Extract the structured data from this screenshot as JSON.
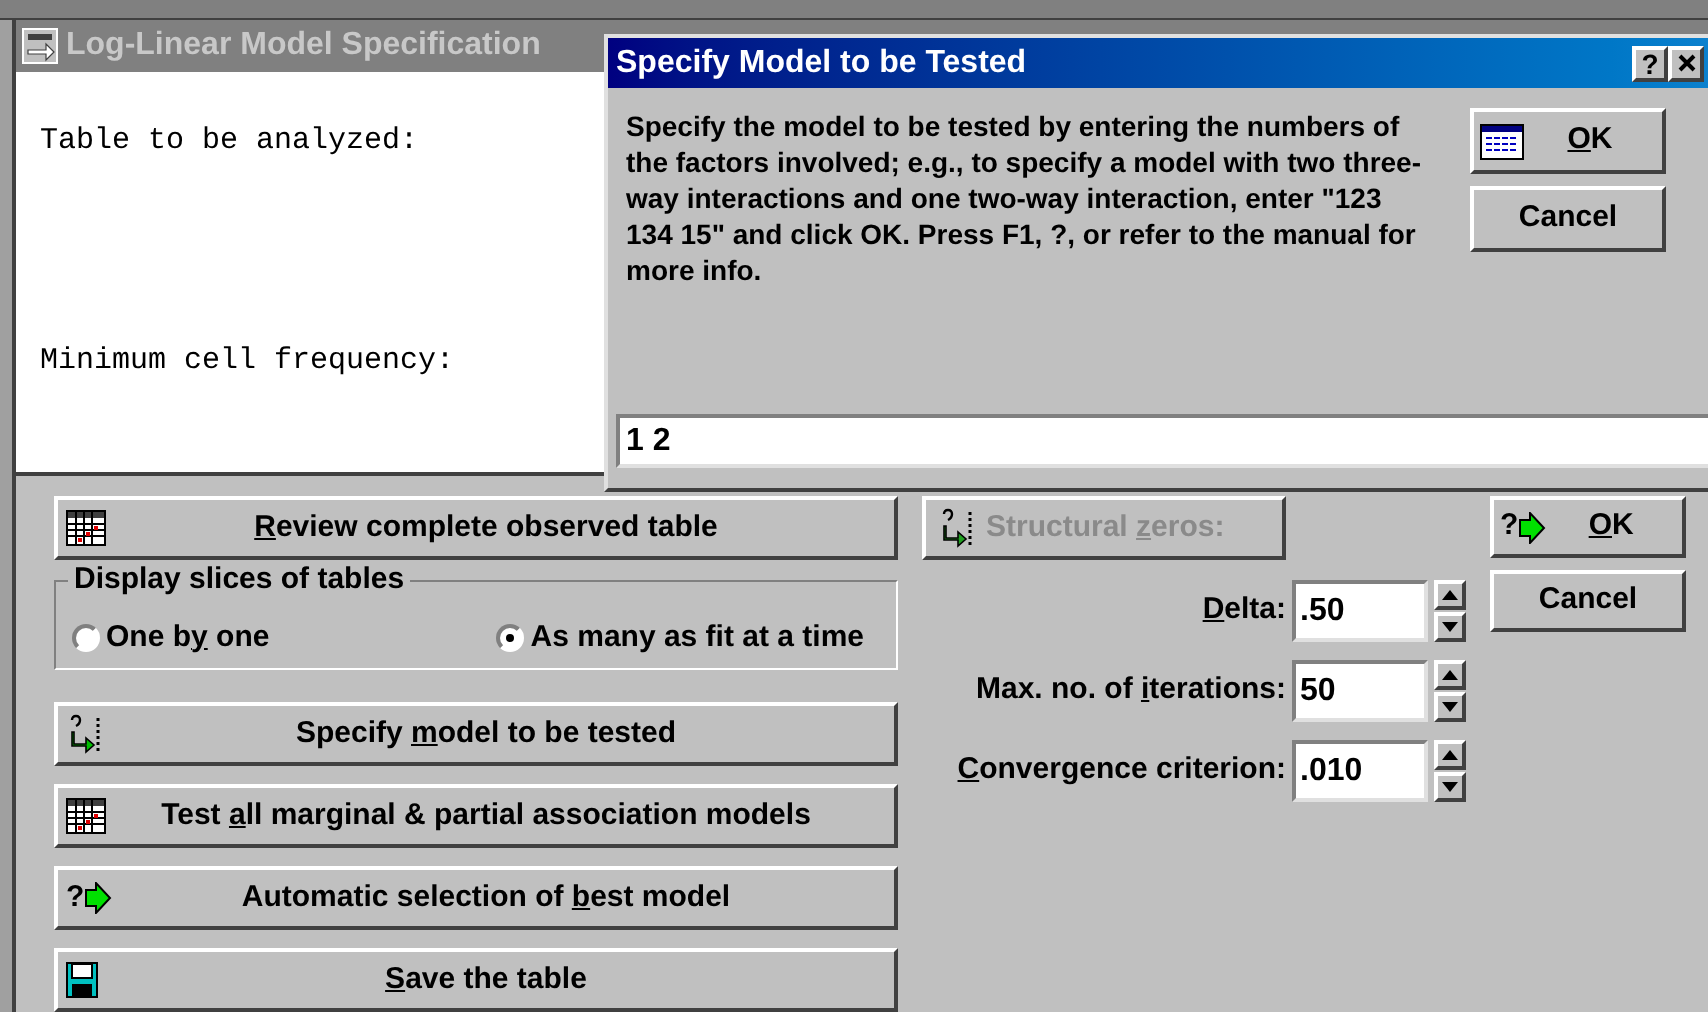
{
  "main_window": {
    "title": "Log-Linear Model Specification",
    "info_labels": [
      "Table to be analyzed:",
      "Minimum cell frequency:"
    ],
    "top_actions": [
      {
        "kind": "table",
        "label": {
          "key": "R",
          "post": "eview complete observed table"
        }
      }
    ],
    "display_slices": {
      "title": "Display slices of tables",
      "options": [
        {
          "label": {
            "pre": "One b",
            "key": "y",
            "post": " one"
          },
          "selected": false
        },
        {
          "label": {
            "pre": "As many as fit at a time"
          },
          "selected": true
        }
      ]
    },
    "actions": [
      {
        "kind": "model",
        "label": {
          "pre": "Specify ",
          "key": "m",
          "post": "odel to be tested"
        }
      },
      {
        "kind": "table",
        "label": {
          "pre": "Test ",
          "key": "a",
          "post": "ll marginal & partial association models"
        }
      },
      {
        "kind": "auto",
        "help_mark": "?",
        "label": {
          "pre": "Automatic selection of ",
          "key": "b",
          "post": "est model"
        }
      },
      {
        "kind": "save",
        "label": {
          "key": "S",
          "post": "ave the table"
        }
      }
    ],
    "structural_zeros": {
      "label": {
        "pre": "Structural ",
        "key": "z",
        "post": "eros:"
      },
      "disabled": true
    },
    "parameters": [
      {
        "label": {
          "key": "D",
          "post": "elta:"
        },
        "value": ".50"
      },
      {
        "label": {
          "pre": "Max. no. of ",
          "key": "i",
          "post": "terations:"
        },
        "value": "50"
      },
      {
        "label": {
          "key": "C",
          "post": "onvergence criterion:"
        },
        "value": ".010"
      }
    ],
    "buttons": [
      {
        "kind": "ok",
        "help_mark": "?",
        "label": {
          "key": "O",
          "post": "K"
        }
      },
      {
        "kind": "cancel",
        "label": {
          "pre": "Cancel"
        }
      }
    ]
  },
  "dialog": {
    "title": "Specify Model to be Tested",
    "help_button": "?",
    "message": "Specify the model to be tested by entering the numbers of the factors involved; e.g., to specify a model with two three-way interactions and one two-way interaction, enter \"123 134 15\" and click OK.  Press F1, ?, or refer to the manual for more info.",
    "input_value": "1 2",
    "buttons": [
      {
        "kind": "ok",
        "label": {
          "key": "O",
          "post": "K"
        }
      },
      {
        "kind": "cancel",
        "label": {
          "pre": "Cancel"
        }
      }
    ]
  }
}
